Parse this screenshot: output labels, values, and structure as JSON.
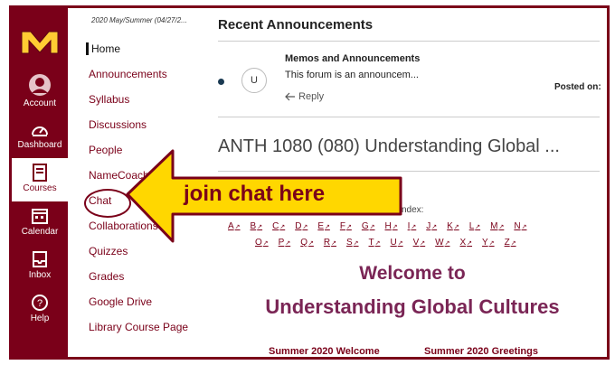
{
  "course_nav": {
    "term": "2020 May/Summer (04/27/2...",
    "items": [
      "Home",
      "Announcements",
      "Syllabus",
      "Discussions",
      "People",
      "NameCoach",
      "Chat",
      "Collaborations",
      "Quizzes",
      "Grades",
      "Google Drive",
      "Library Course Page"
    ]
  },
  "global_nav": {
    "items": [
      {
        "label": "Account",
        "icon": "account-icon"
      },
      {
        "label": "Dashboard",
        "icon": "dashboard-icon"
      },
      {
        "label": "Courses",
        "icon": "courses-icon"
      },
      {
        "label": "Calendar",
        "icon": "calendar-icon"
      },
      {
        "label": "Inbox",
        "icon": "inbox-icon"
      },
      {
        "label": "Help",
        "icon": "help-icon"
      }
    ],
    "active": "Courses",
    "brand_color": "#7a0019",
    "logo_color": "#ffcc33"
  },
  "recent": {
    "heading": "Recent Announcements",
    "item": {
      "avatar_initial": "U",
      "title": "Memos and Announcements",
      "excerpt": "This forum is an announcem...",
      "reply": "Reply",
      "posted": "Posted on:"
    }
  },
  "course": {
    "title": "ANTH 1080 (080) Understanding Global ...",
    "index_label": "ndex:",
    "index_row1": [
      "A",
      "B",
      "C",
      "D",
      "E",
      "F",
      "G",
      "H",
      "I",
      "J",
      "K",
      "L",
      "M",
      "N"
    ],
    "index_row2": [
      "O",
      "P",
      "Q",
      "R",
      "S",
      "T",
      "U",
      "V",
      "W",
      "X",
      "Y",
      "Z"
    ],
    "welcome_line1": "Welcome to",
    "welcome_line2": "Understanding Global Cultures",
    "link_left": "Summer 2020 Welcome",
    "link_right": "Summer 2020 Greetings"
  },
  "callout": {
    "text": "join chat here",
    "fill": "#ffd700",
    "stroke": "#7a0019"
  }
}
